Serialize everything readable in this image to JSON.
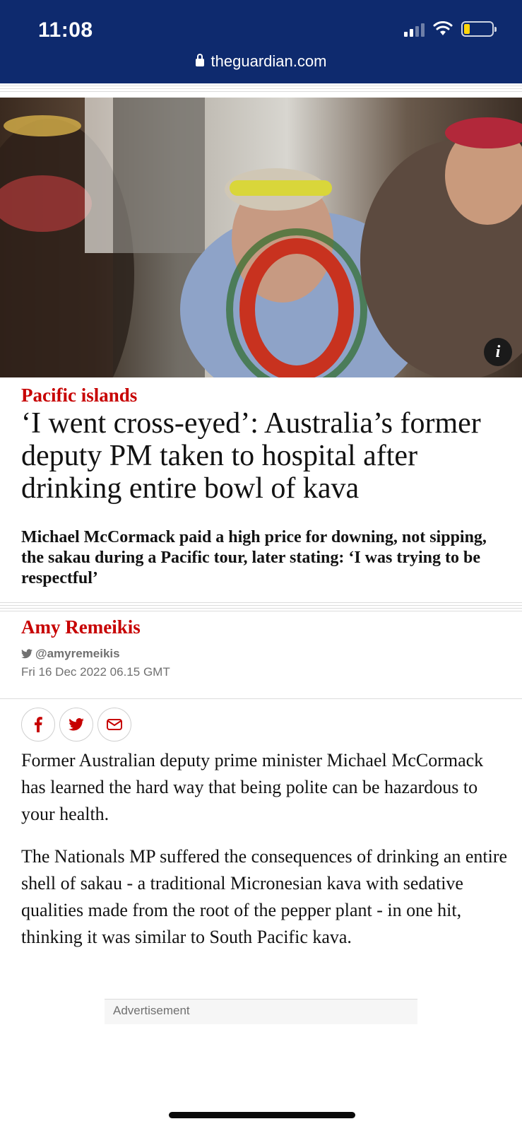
{
  "status_bar": {
    "time": "11:08",
    "icons": [
      "signal-icon",
      "wifi-icon",
      "battery-icon"
    ],
    "battery_color": "#ffd60a"
  },
  "browser": {
    "url": "theguardian.com",
    "bar_color": "#0e2a6e"
  },
  "hero": {
    "info_label": "i"
  },
  "article": {
    "kicker": "Pacific islands",
    "headline": "‘I went cross-eyed’: Australia’s former deputy PM taken to hospital after drinking entire bowl of kava",
    "standfirst": "Michael McCormack paid a high price for downing, not sipping, the sakau during a Pacific tour, later stating: ‘I was trying to be respectful’",
    "author": "Amy Remeikis",
    "twitter_handle": "@amyremeikis",
    "date": "Fri 16 Dec 2022 06.15 GMT",
    "share": [
      "facebook-icon",
      "twitter-icon",
      "email-icon"
    ],
    "paragraphs": [
      "Former Australian deputy prime minister Michael McCormack has learned the hard way that being polite can be hazardous to your health.",
      "The Nationals MP suffered the consequences of drinking an entire shell of sakau - a traditional Micronesian kava with sedative qualities made from the root of the pepper plant - in one hit, thinking it was similar to South Pacific kava."
    ],
    "accent_color": "#c70000"
  },
  "advertisement": {
    "label": "Advertisement"
  }
}
